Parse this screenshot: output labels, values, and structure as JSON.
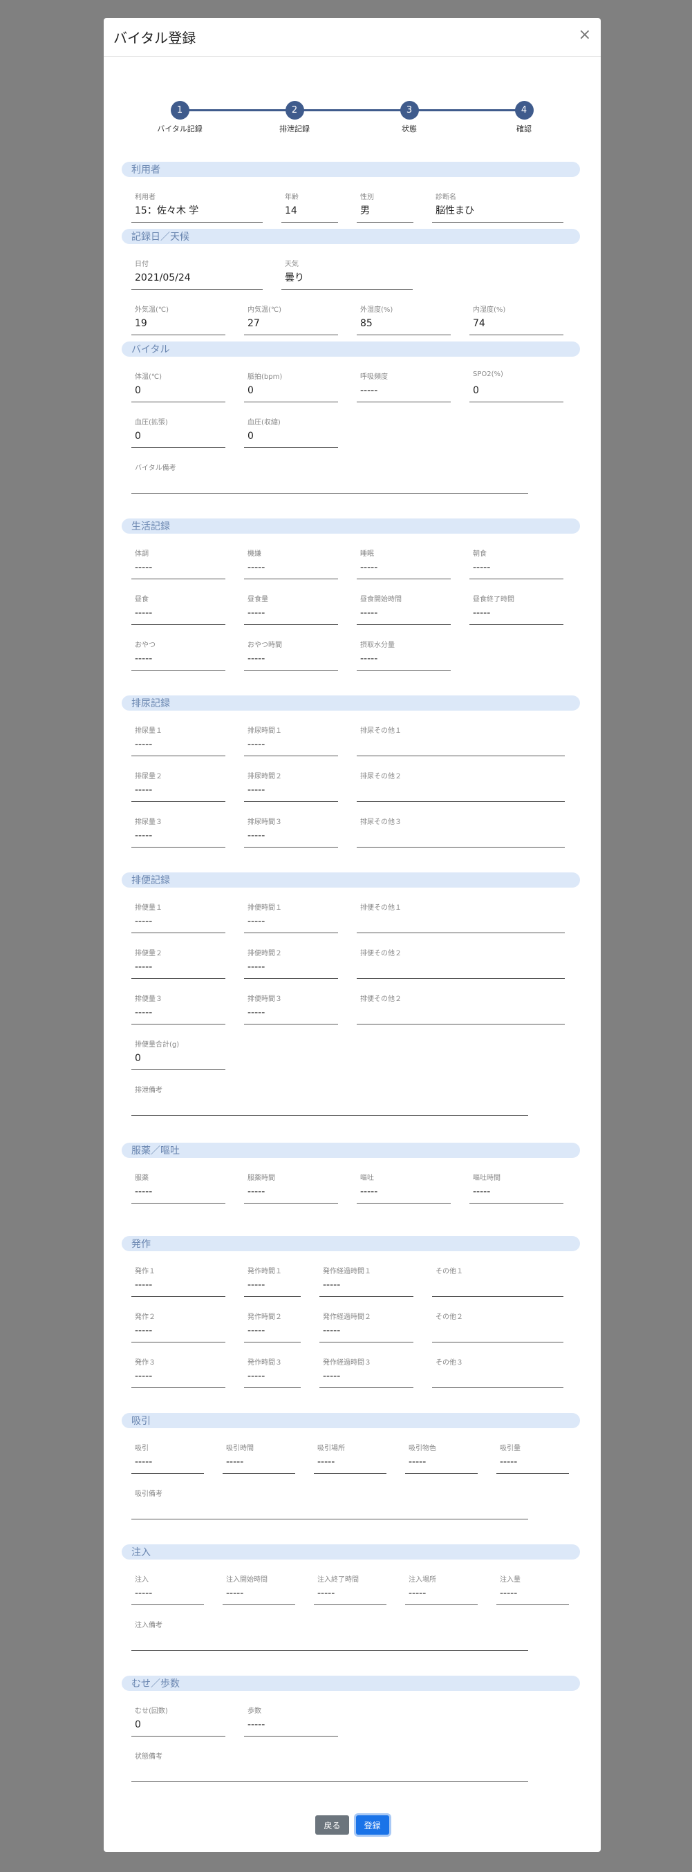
{
  "title": "バイタル登録",
  "close": "×",
  "steps": [
    {
      "num": "1",
      "label": "バイタル記録"
    },
    {
      "num": "2",
      "label": "排泄記録"
    },
    {
      "num": "3",
      "label": "状態"
    },
    {
      "num": "4",
      "label": "確認"
    }
  ],
  "sections": {
    "user": {
      "title": "利用者",
      "user_label": "利用者",
      "user_value": "15：佐々木 学",
      "age_label": "年齢",
      "age_value": "14",
      "sex_label": "性別",
      "sex_value": "男",
      "diag_label": "診断名",
      "diag_value": "脳性まひ"
    },
    "date": {
      "title": "記録日／天候",
      "date_label": "日付",
      "date_value": "2021/05/24",
      "weather_label": "天気",
      "weather_value": "曇り",
      "out_temp_label": "外気温(℃)",
      "out_temp_value": "19",
      "in_temp_label": "内気温(℃)",
      "in_temp_value": "27",
      "out_hum_label": "外湿度(%)",
      "out_hum_value": "85",
      "in_hum_label": "内湿度(%)",
      "in_hum_value": "74"
    },
    "vital": {
      "title": "バイタル",
      "temp_label": "体温(℃)",
      "temp_value": "0",
      "pulse_label": "脈拍(bpm)",
      "pulse_value": "0",
      "resp_label": "呼吸頻度",
      "resp_value": "-----",
      "spo2_label": "SPO2(%)",
      "spo2_value": "0",
      "bp_high_label": "血圧(拡張)",
      "bp_high_value": "0",
      "bp_low_label": "血圧(収縮)",
      "bp_low_value": "0",
      "note_label": "バイタル備考",
      "note_value": ""
    },
    "life": {
      "title": "生活記録",
      "items": [
        {
          "label": "体調",
          "value": "-----"
        },
        {
          "label": "機嫌",
          "value": "-----"
        },
        {
          "label": "睡眠",
          "value": "-----"
        },
        {
          "label": "朝食",
          "value": "-----"
        },
        {
          "label": "昼食",
          "value": "-----"
        },
        {
          "label": "昼食量",
          "value": "-----"
        },
        {
          "label": "昼食開始時間",
          "value": "-----"
        },
        {
          "label": "昼食終了時間",
          "value": "-----"
        },
        {
          "label": "おやつ",
          "value": "-----"
        },
        {
          "label": "おやつ時間",
          "value": "-----"
        },
        {
          "label": "摂取水分量",
          "value": "-----"
        }
      ]
    },
    "urine": {
      "title": "排尿記録",
      "rows": [
        {
          "amount_label": "排尿量１",
          "amount_value": "-----",
          "time_label": "排尿時間１",
          "time_value": "-----",
          "other_label": "排尿その他１",
          "other_value": ""
        },
        {
          "amount_label": "排尿量２",
          "amount_value": "-----",
          "time_label": "排尿時間２",
          "time_value": "-----",
          "other_label": "排尿その他２",
          "other_value": ""
        },
        {
          "amount_label": "排尿量３",
          "amount_value": "-----",
          "time_label": "排尿時間３",
          "time_value": "-----",
          "other_label": "排尿その他３",
          "other_value": ""
        }
      ]
    },
    "stool": {
      "title": "排便記録",
      "rows": [
        {
          "amount_label": "排便量１",
          "amount_value": "-----",
          "time_label": "排便時間１",
          "time_value": "-----",
          "other_label": "排便その他１",
          "other_value": ""
        },
        {
          "amount_label": "排便量２",
          "amount_value": "-----",
          "time_label": "排便時間２",
          "time_value": "-----",
          "other_label": "排便その他２",
          "other_value": ""
        },
        {
          "amount_label": "排便量３",
          "amount_value": "-----",
          "time_label": "排便時間３",
          "time_value": "-----",
          "other_label": "排便その他２",
          "other_value": ""
        }
      ],
      "total_label": "排便量合計(g)",
      "total_value": "0",
      "note_label": "排泄備考",
      "note_value": ""
    },
    "med": {
      "title": "服薬／嘔吐",
      "med_label": "服薬",
      "med_value": "-----",
      "med_time_label": "服薬時間",
      "med_time_value": "-----",
      "vomit_label": "嘔吐",
      "vomit_value": "-----",
      "vomit_time_label": "嘔吐時間",
      "vomit_time_value": "-----"
    },
    "seizure": {
      "title": "発作",
      "rows": [
        {
          "a_label": "発作１",
          "a_value": "-----",
          "b_label": "発作時間１",
          "b_value": "-----",
          "c_label": "発作経過時間１",
          "c_value": "-----",
          "d_label": "その他１",
          "d_value": ""
        },
        {
          "a_label": "発作２",
          "a_value": "-----",
          "b_label": "発作時間２",
          "b_value": "-----",
          "c_label": "発作経過時間２",
          "c_value": "-----",
          "d_label": "その他２",
          "d_value": ""
        },
        {
          "a_label": "発作３",
          "a_value": "-----",
          "b_label": "発作時間３",
          "b_value": "-----",
          "c_label": "発作経過時間３",
          "c_value": "-----",
          "d_label": "その他３",
          "d_value": ""
        }
      ]
    },
    "suction": {
      "title": "吸引",
      "items": [
        {
          "label": "吸引",
          "value": "-----"
        },
        {
          "label": "吸引時間",
          "value": "-----"
        },
        {
          "label": "吸引場所",
          "value": "-----"
        },
        {
          "label": "吸引物色",
          "value": "-----"
        },
        {
          "label": "吸引量",
          "value": "-----"
        }
      ],
      "note_label": "吸引備考",
      "note_value": ""
    },
    "injection": {
      "title": "注入",
      "items": [
        {
          "label": "注入",
          "value": "-----"
        },
        {
          "label": "注入開始時間",
          "value": "-----"
        },
        {
          "label": "注入終了時間",
          "value": "-----"
        },
        {
          "label": "注入場所",
          "value": "-----"
        },
        {
          "label": "注入量",
          "value": "-----"
        }
      ],
      "note_label": "注入備考",
      "note_value": ""
    },
    "choke": {
      "title": "むせ／歩数",
      "choke_label": "むせ(回数)",
      "choke_value": "0",
      "steps_label": "歩数",
      "steps_value": "-----",
      "note_label": "状態備考",
      "note_value": ""
    }
  },
  "buttons": {
    "back": "戻る",
    "submit": "登録"
  }
}
